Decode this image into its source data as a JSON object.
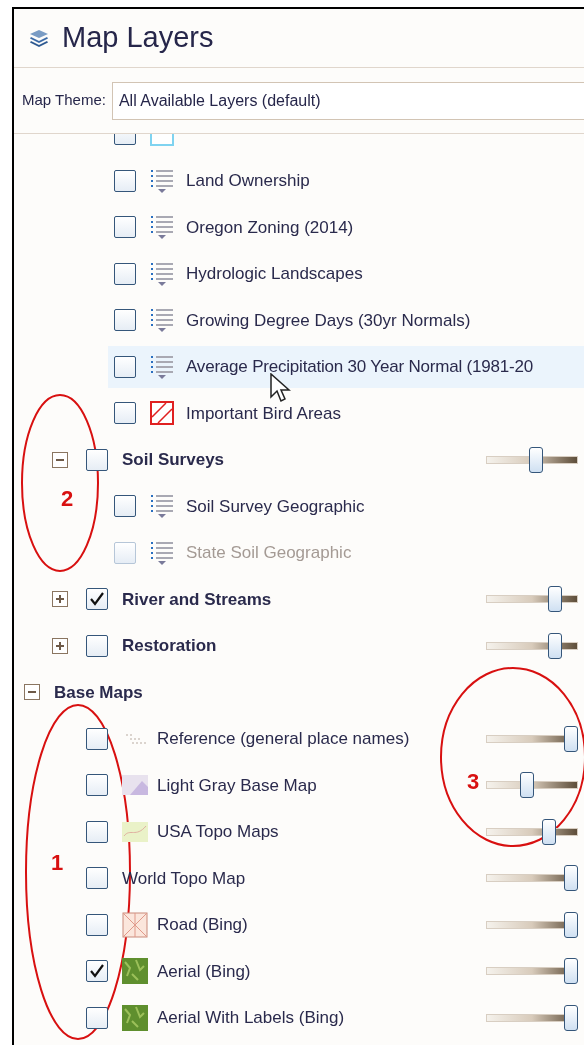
{
  "panel": {
    "title": "Map Layers"
  },
  "map_theme": {
    "label": "Map Theme:",
    "value": "All Available Layers (default)"
  },
  "tree": [
    {
      "children": [
        {
          "children": [
            {
              "kind": "outline",
              "checked": false,
              "disabled": false,
              "highlighted": false
            },
            {
              "kind": "legend",
              "label": "Land Ownership",
              "checked": false,
              "disabled": false,
              "highlighted": false
            },
            {
              "kind": "legend",
              "label": "Oregon Zoning (2014)",
              "checked": false,
              "disabled": false,
              "highlighted": false
            },
            {
              "kind": "legend",
              "label": "Hydrologic Landscapes",
              "checked": false,
              "disabled": false,
              "highlighted": false
            },
            {
              "kind": "legend",
              "label": "Growing Degree Days (30yr Normals)",
              "checked": false,
              "disabled": false,
              "highlighted": false
            },
            {
              "kind": "legend",
              "label": "Average Precipitation 30 Year Normal (1981-20",
              "checked": false,
              "disabled": false,
              "highlighted": true
            },
            {
              "kind": "hatch",
              "label": "Important Bird Areas",
              "checked": false,
              "disabled": false,
              "highlighted": false
            }
          ]
        },
        {
          "kind": "group",
          "label": "Soil Surveys",
          "expanded": true,
          "checked": false,
          "level": 0.55,
          "children": [
            {
              "kind": "legend",
              "label": "Soil Survey Geographic",
              "checked": false,
              "disabled": false,
              "highlighted": false
            },
            {
              "kind": "legend",
              "label": "State Soil Geographic",
              "checked": false,
              "disabled": true,
              "highlighted": false
            }
          ]
        },
        {
          "kind": "group",
          "label": "River and Streams",
          "expanded": false,
          "checked": true,
          "level": 0.8
        },
        {
          "kind": "group",
          "label": "Restoration",
          "expanded": false,
          "checked": false,
          "level": 0.8
        }
      ]
    },
    {
      "kind": "section",
      "label": "Base Maps",
      "expanded": true,
      "children": [
        {
          "kind": "reference",
          "label": "Reference (general place names)",
          "checked": false,
          "disabled": false,
          "highlighted": false,
          "level": 1
        },
        {
          "kind": "lightgray",
          "label": "Light Gray Base Map",
          "checked": false,
          "disabled": false,
          "highlighted": false,
          "level": 0.43
        },
        {
          "kind": "topo",
          "label": "USA Topo Maps",
          "checked": false,
          "disabled": false,
          "highlighted": false,
          "level": 0.72
        },
        {
          "kind": "plain",
          "label": "World Topo Map",
          "checked": false,
          "disabled": false,
          "highlighted": false,
          "level": 1
        },
        {
          "kind": "road",
          "label": "Road (Bing)",
          "checked": false,
          "disabled": false,
          "highlighted": false,
          "level": 1
        },
        {
          "kind": "aerial",
          "label": "Aerial (Bing)",
          "checked": true,
          "disabled": false,
          "highlighted": false,
          "level": 1
        },
        {
          "kind": "aerial",
          "label": "Aerial With Labels (Bing)",
          "checked": false,
          "disabled": false,
          "highlighted": false,
          "level": 1
        }
      ]
    }
  ],
  "annotations": [
    {
      "label": "2"
    },
    {
      "label": "1"
    },
    {
      "label": "3"
    }
  ]
}
